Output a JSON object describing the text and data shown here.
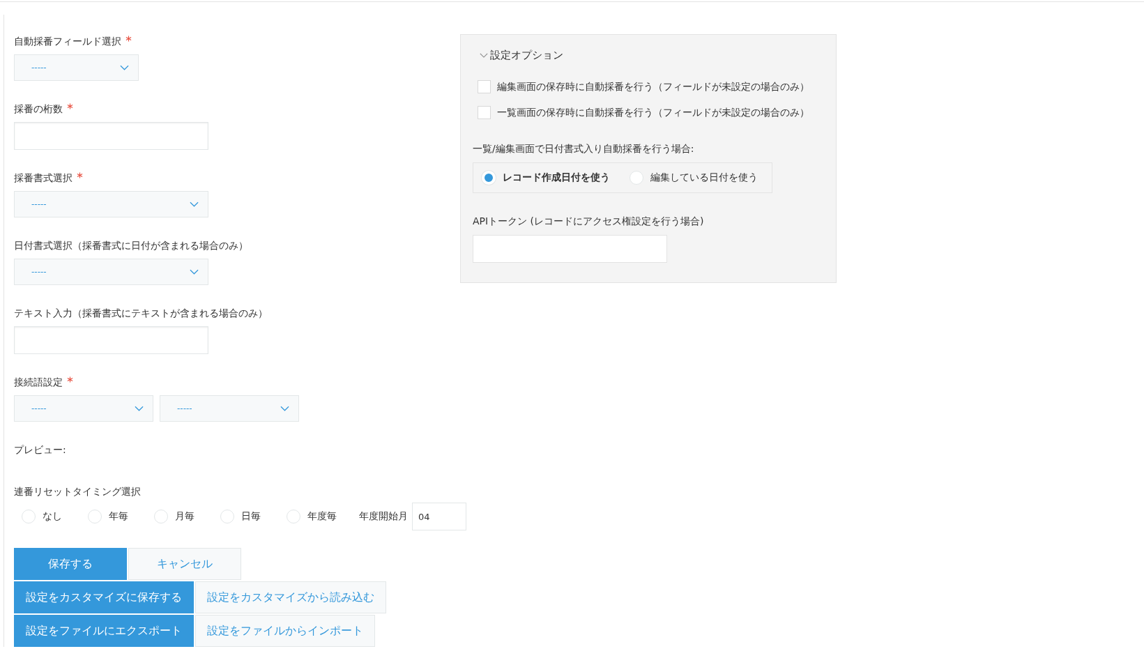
{
  "fields": [
    {
      "kind": "select",
      "label": "自動採番フィールド選択",
      "required": true,
      "options": [
        "-----"
      ]
    },
    {
      "kind": "input",
      "label": "採番の桁数",
      "required": true
    },
    {
      "kind": "select",
      "label": "採番書式選択",
      "required": true,
      "options": [
        "-----"
      ]
    },
    {
      "kind": "select",
      "label": "日付書式選択（採番書式に日付が含まれる場合のみ）",
      "required": false,
      "options": [
        "-----"
      ]
    },
    {
      "kind": "input",
      "label": "テキスト入力（採番書式にテキストが含まれる場合のみ）",
      "required": false
    },
    {
      "kind": "select",
      "label": "接続語設定",
      "required": true,
      "options": [
        "-----",
        "-----"
      ]
    }
  ],
  "preview": {
    "label": "プレビュー:"
  },
  "reset": {
    "label": "連番リセットタイミング選択",
    "options": [
      {
        "label": "なし",
        "selected": false
      },
      {
        "label": "年毎",
        "selected": false
      },
      {
        "label": "月毎",
        "selected": false
      },
      {
        "label": "日毎",
        "selected": false
      },
      {
        "label": "年度毎",
        "selected": false
      }
    ],
    "month_label": "年度開始月",
    "month_value": "04"
  },
  "button_rows": [
    [
      {
        "label": "保存する",
        "kind": "primary"
      },
      {
        "label": "キャンセル",
        "kind": "secondary"
      }
    ],
    [
      {
        "label": "設定をカスタマイズに保存する",
        "kind": "primary"
      },
      {
        "label": "設定をカスタマイズから読み込む",
        "kind": "secondary"
      }
    ],
    [
      {
        "label": "設定をファイルにエクスポート",
        "kind": "primary"
      },
      {
        "label": "設定をファイルからインポート",
        "kind": "secondary"
      }
    ]
  ],
  "options_panel": {
    "title": "設定オプション",
    "expanded": true,
    "checkboxes": [
      {
        "label": "編集画面の保存時に自動採番を行う（フィールドが未設定の場合のみ）",
        "checked": false
      },
      {
        "label": "一覧画面の保存時に自動採番を行う（フィールドが未設定の場合のみ）",
        "checked": false
      }
    ],
    "date_mode": {
      "label": "一覧/編集画面で日付書式入り自動採番を行う場合:",
      "options": [
        {
          "label": "レコード作成日付を使う",
          "selected": true
        },
        {
          "label": "編集している日付を使う",
          "selected": false
        }
      ]
    },
    "api_token": {
      "label": "APIトークン (レコードにアクセス権設定を行う場合)"
    }
  }
}
